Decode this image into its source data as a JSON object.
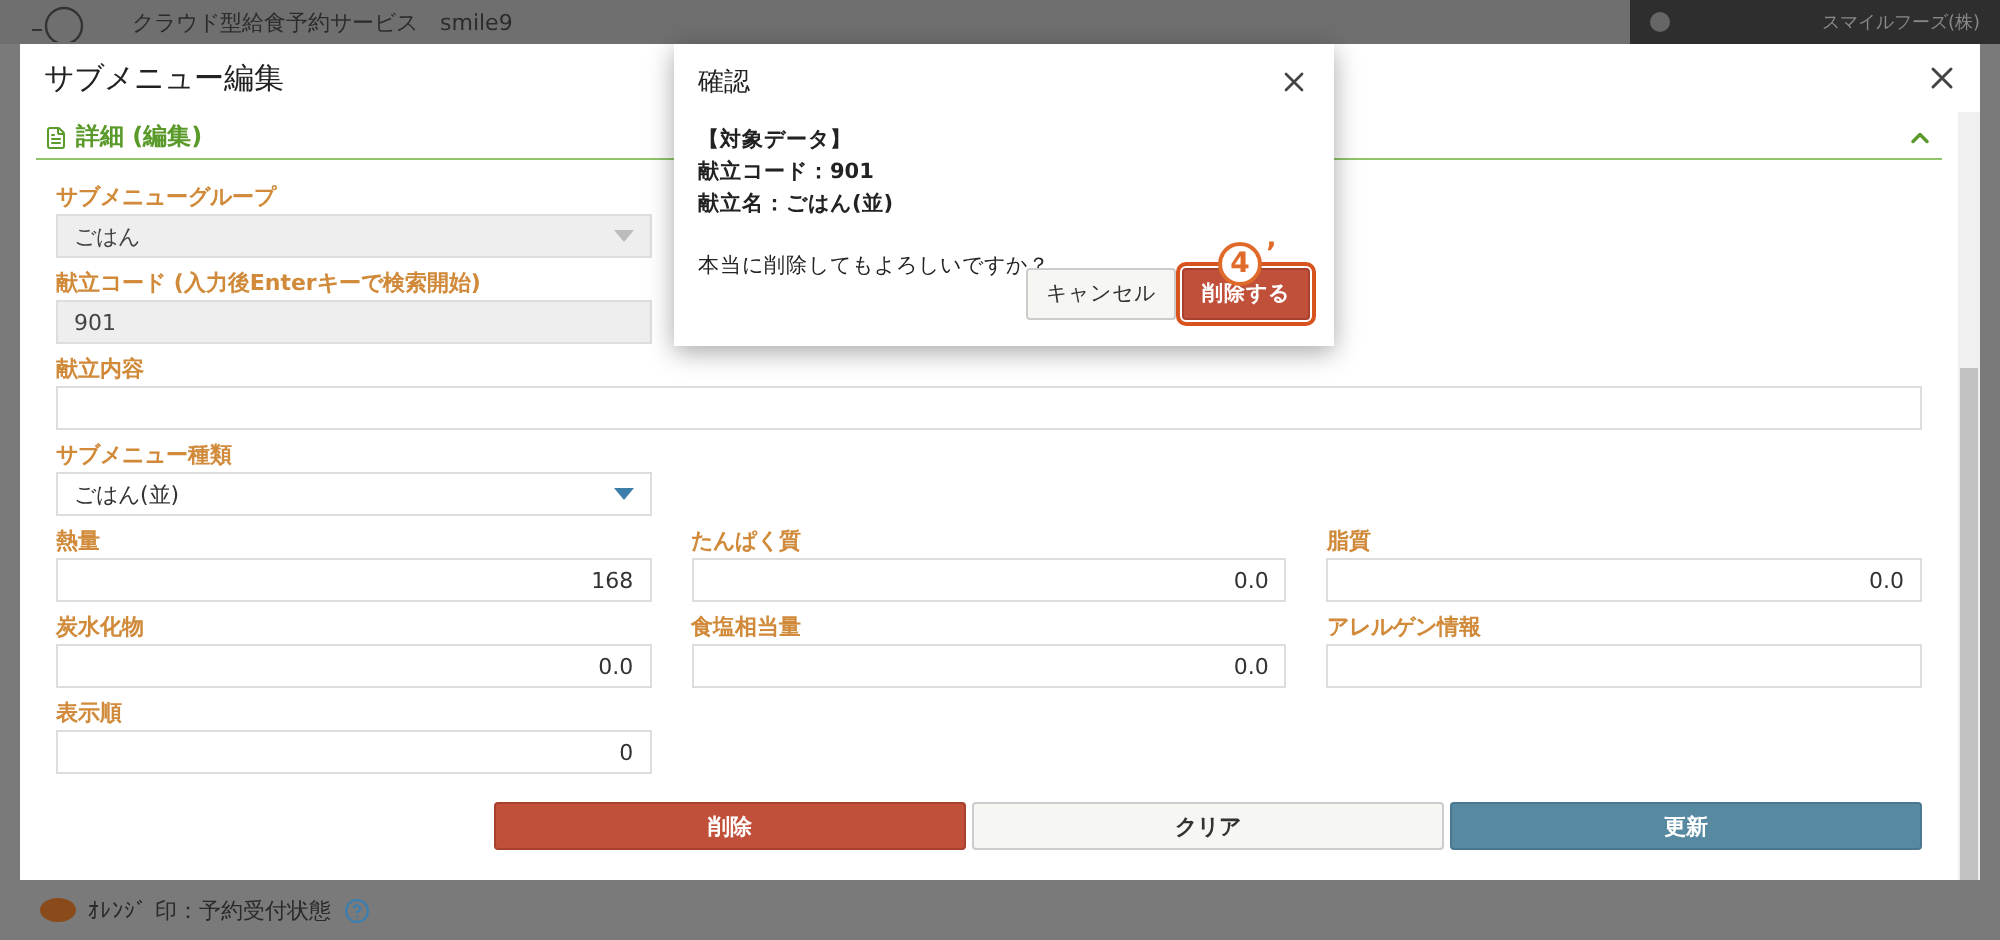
{
  "header": {
    "service_name": "クラウド型給食予約サービス　smile9",
    "user": "スマイルフーズ(株)"
  },
  "editor": {
    "title": "サブメニュー編集",
    "section": {
      "title": "詳細 (編集)",
      "expanded": true
    },
    "rows": [
      {
        "kind": "grid",
        "fields": [
          {
            "label": "サブメニューグループ",
            "kind": "select",
            "value": "ごはん",
            "disabled": true
          }
        ]
      },
      {
        "kind": "grid",
        "fields": [
          {
            "label": "献立コード (入力後Enterキーで検索開始)",
            "kind": "text",
            "value": "901",
            "disabled": true
          }
        ]
      },
      {
        "kind": "full",
        "fields": [
          {
            "label": "献立内容",
            "kind": "text",
            "disabled": false
          }
        ]
      },
      {
        "kind": "grid",
        "fields": [
          {
            "label": "サブメニュー種類",
            "kind": "select",
            "value": "ごはん(並)",
            "disabled": false
          }
        ]
      },
      {
        "kind": "grid",
        "fields": [
          {
            "label": "熱量",
            "kind": "number",
            "value": "168",
            "disabled": false
          },
          {
            "label": "たんぱく質",
            "kind": "number",
            "value": "0.0",
            "disabled": false
          },
          {
            "label": "脂質",
            "kind": "number",
            "value": "0.0",
            "disabled": false
          }
        ]
      },
      {
        "kind": "grid",
        "fields": [
          {
            "label": "炭水化物",
            "kind": "number",
            "value": "0.0",
            "disabled": false
          },
          {
            "label": "食塩相当量",
            "kind": "number",
            "value": "0.0",
            "disabled": false
          },
          {
            "label": "アレルゲン情報",
            "kind": "text",
            "disabled": false
          }
        ]
      },
      {
        "kind": "grid",
        "fields": [
          {
            "label": "表示順",
            "kind": "number",
            "value": "0",
            "disabled": false
          }
        ]
      }
    ],
    "buttons": [
      {
        "label": "削除",
        "kind": "danger"
      },
      {
        "label": "クリア",
        "kind": "default"
      },
      {
        "label": "更新",
        "kind": "primary"
      }
    ]
  },
  "confirm": {
    "title": "確認",
    "lines": [
      "【対象データ】",
      "献立コード：901",
      "献立名：ごはん(並)"
    ],
    "question": "本当に削除してもよろしいですか？",
    "buttons": [
      {
        "label": "キャンセル",
        "kind": "default",
        "highlighted": false
      },
      {
        "label": "削除する",
        "kind": "danger",
        "highlighted": true
      }
    ],
    "annotation": {
      "number": "4",
      "mark": "’"
    }
  },
  "footer": {
    "legend": "ｵﾚﾝｼﾞ 印：予約受付状態"
  }
}
